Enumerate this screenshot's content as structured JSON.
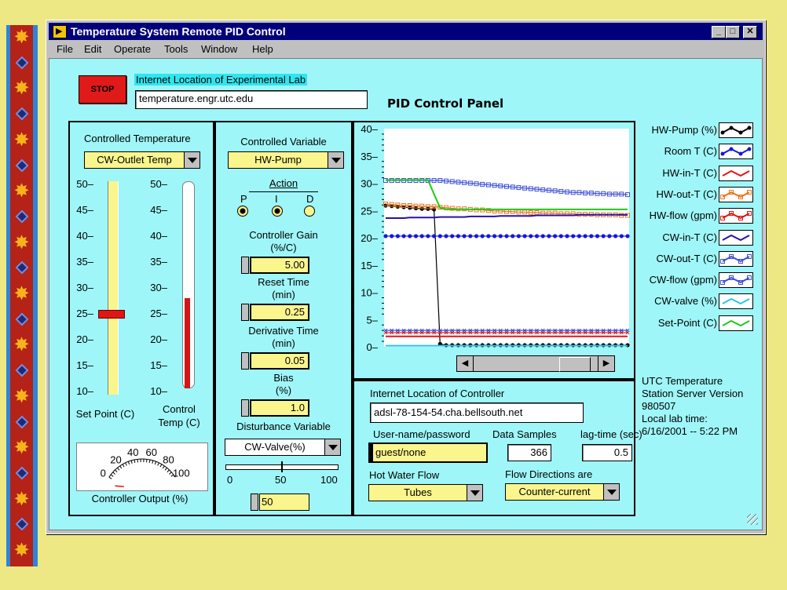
{
  "window": {
    "title": "Temperature System Remote PID Control",
    "minimize": "_",
    "maximize": "□",
    "close": "✕"
  },
  "menu": [
    "File",
    "Edit",
    "Operate",
    "Tools",
    "Window",
    "Help"
  ],
  "header": {
    "stop_label": "STOP",
    "lab_location_label": "Internet Location of Experimental Lab",
    "lab_location_value": "temperature.engr.utc.edu",
    "panel_title": "PID Control Panel"
  },
  "temperature": {
    "controlled_label": "Controlled Temperature",
    "controlled_value": "CW-Outlet Temp",
    "scale": [
      "50",
      "45",
      "40",
      "35",
      "30",
      "25",
      "20",
      "15",
      "10"
    ],
    "set_point_value": 25,
    "control_temp_value": 28,
    "set_point_label": "Set Point (C)",
    "control_temp_label": "Control Temp (C)"
  },
  "meter": {
    "labels": [
      "0",
      "20",
      "40",
      "60",
      "80",
      "100"
    ],
    "value_fraction": 0.0,
    "title": "Controller Output (%)"
  },
  "controller": {
    "variable_label": "Controlled Variable",
    "variable_value": "HW-Pump",
    "action_label": "Action",
    "action_letters": [
      "P",
      "I",
      "D"
    ],
    "action_states": [
      true,
      true,
      false
    ],
    "gain_label_1": "Controller Gain",
    "gain_label_2": "(%/C)",
    "gain_value": "5.00",
    "reset_label_1": "Reset Time",
    "reset_label_2": "(min)",
    "reset_value": "0.25",
    "deriv_label_1": "Derivative Time",
    "deriv_label_2": "(min)",
    "deriv_value": "0.05",
    "bias_label_1": "Bias",
    "bias_label_2": "(%)",
    "bias_value": "1.0",
    "disturbance_label": "Disturbance Variable",
    "disturbance_value": "CW-Valve(%)",
    "slider_ticks": [
      "0",
      "50",
      "100"
    ],
    "slider_fraction": 0.5,
    "disturbance_numeric": "50"
  },
  "chart_data": {
    "type": "line",
    "ylim": [
      0,
      40
    ],
    "yticks": [
      "40",
      "35",
      "30",
      "25",
      "20",
      "15",
      "10",
      "5",
      "0"
    ],
    "x": [
      0,
      1,
      2,
      3,
      4,
      5,
      6,
      7,
      8,
      9,
      10,
      11,
      12,
      13,
      14,
      15,
      16,
      17,
      18,
      19,
      20,
      21,
      22,
      23,
      24,
      25,
      26,
      27,
      28,
      29,
      30,
      31,
      32,
      33,
      34,
      35,
      36,
      37,
      38,
      39,
      40
    ],
    "series": [
      {
        "name": "HW-Pump (%)",
        "color": "#000000",
        "marker": "dot",
        "values": [
          25.9,
          25.8,
          25.7,
          25.6,
          25.5,
          25.4,
          25.3,
          25.3,
          25.2,
          0.5,
          0.3,
          0.3,
          0.3,
          0.3,
          0.3,
          0.3,
          0.3,
          0.3,
          0.3,
          0.3,
          0.3,
          0.3,
          0.3,
          0.3,
          0.3,
          0.3,
          0.3,
          0.3,
          0.3,
          0.3,
          0.3,
          0.3,
          0.3,
          0.3,
          0.3,
          0.3,
          0.3,
          0.3,
          0.3,
          0.3,
          0.3
        ]
      },
      {
        "name": "Room T (C)",
        "color": "#1515e0",
        "marker": "dot",
        "values": [
          20.3,
          20.3,
          20.3,
          20.3,
          20.3,
          20.3,
          20.3,
          20.3,
          20.3,
          20.3,
          20.3,
          20.3,
          20.3,
          20.3,
          20.3,
          20.3,
          20.3,
          20.3,
          20.3,
          20.3,
          20.3,
          20.3,
          20.3,
          20.3,
          20.3,
          20.3,
          20.3,
          20.3,
          20.3,
          20.3,
          20.3,
          20.3,
          20.3,
          20.3,
          20.3,
          20.3,
          20.3,
          20.3,
          20.3,
          20.3,
          20.3
        ]
      },
      {
        "name": "HW-in-T (C)",
        "color": "#e01515",
        "marker": "none",
        "values": [
          1.9,
          1.9,
          1.9,
          1.9,
          1.9,
          1.9,
          1.9,
          1.9,
          1.9,
          1.9,
          1.9,
          1.9,
          1.9,
          1.9,
          1.9,
          1.9,
          1.9,
          1.9,
          1.9,
          1.9,
          1.9,
          1.9,
          1.9,
          1.9,
          1.9,
          1.9,
          1.9,
          1.9,
          1.9,
          1.9,
          1.9,
          1.9,
          1.9,
          1.9,
          1.9,
          1.9,
          1.9,
          1.9,
          1.9,
          1.9,
          1.9
        ]
      },
      {
        "name": "HW-out-T (C)",
        "color": "#e8761f",
        "marker": "square",
        "values": [
          26.2,
          26.1,
          26.0,
          25.9,
          25.9,
          25.8,
          25.8,
          25.7,
          25.7,
          25.6,
          25.5,
          25.4,
          25.3,
          25.3,
          25.2,
          25.1,
          25.1,
          25.0,
          24.9,
          24.9,
          24.8,
          24.8,
          24.7,
          24.7,
          24.6,
          24.6,
          24.5,
          24.5,
          24.5,
          24.4,
          24.4,
          24.4,
          24.3,
          24.3,
          24.3,
          24.2,
          24.2,
          24.2,
          24.2,
          24.1,
          24.1
        ]
      },
      {
        "name": "HW-flow (gpm)",
        "color": "#e01515",
        "marker": "x",
        "values": [
          2.6,
          2.6,
          2.6,
          2.6,
          2.6,
          2.6,
          2.6,
          2.6,
          2.6,
          2.6,
          2.6,
          2.6,
          2.6,
          2.6,
          2.6,
          2.6,
          2.6,
          2.6,
          2.6,
          2.6,
          2.6,
          2.6,
          2.6,
          2.6,
          2.6,
          2.6,
          2.6,
          2.6,
          2.6,
          2.6,
          2.6,
          2.6,
          2.6,
          2.6,
          2.6,
          2.6,
          2.6,
          2.6,
          2.6,
          2.6,
          2.6
        ]
      },
      {
        "name": "CW-in-T (C)",
        "color": "#2a10a8",
        "marker": "none",
        "values": [
          23.6,
          23.6,
          23.6,
          23.6,
          23.7,
          23.7,
          23.7,
          23.7,
          23.7,
          23.8,
          23.8,
          23.8,
          23.8,
          23.8,
          23.9,
          23.9,
          23.9,
          23.9,
          23.9,
          24.0,
          24.0,
          24.0,
          24.0,
          24.0,
          24.0,
          24.1,
          24.1,
          24.1,
          24.1,
          24.1,
          24.1,
          24.1,
          24.2,
          24.2,
          24.2,
          24.2,
          24.2,
          24.2,
          24.2,
          24.2,
          24.2
        ]
      },
      {
        "name": "CW-out-T (C)",
        "color": "#3c4fd6",
        "marker": "square",
        "values": [
          30.5,
          30.5,
          30.5,
          30.5,
          30.5,
          30.5,
          30.5,
          30.5,
          30.5,
          30.5,
          30.4,
          30.3,
          30.2,
          30.1,
          30.0,
          29.9,
          29.8,
          29.7,
          29.6,
          29.5,
          29.4,
          29.3,
          29.2,
          29.1,
          29.0,
          28.9,
          28.8,
          28.7,
          28.6,
          28.5,
          28.4,
          28.3,
          28.3,
          28.2,
          28.2,
          28.1,
          28.1,
          28.0,
          28.0,
          28.0,
          27.9
        ]
      },
      {
        "name": "CW-flow (gpm)",
        "color": "#3c4fd6",
        "marker": "x",
        "values": [
          3.0,
          3.0,
          3.0,
          3.0,
          3.0,
          3.0,
          3.0,
          3.0,
          3.0,
          3.0,
          3.0,
          3.0,
          3.0,
          3.0,
          3.0,
          3.0,
          3.0,
          3.0,
          3.0,
          3.0,
          3.0,
          3.0,
          3.0,
          3.0,
          3.0,
          3.0,
          3.0,
          3.0,
          3.0,
          3.0,
          3.0,
          3.0,
          3.0,
          3.0,
          3.0,
          3.0,
          3.0,
          3.0,
          3.0,
          3.0,
          3.0
        ]
      },
      {
        "name": "CW-valve (%)",
        "color": "#2cc3ea",
        "marker": "none",
        "values": [
          0.2,
          0.2,
          0.2,
          0.2,
          0.2,
          0.2,
          0.2,
          0.2,
          0.2,
          0.2,
          0.2,
          0.2,
          0.2,
          0.2,
          0.2,
          0.2,
          0.2,
          0.2,
          0.2,
          0.2,
          0.2,
          0.2,
          0.2,
          0.2,
          0.2,
          0.2,
          0.2,
          0.2,
          0.2,
          0.2,
          0.2,
          0.2,
          0.2,
          0.2,
          0.2,
          0.2,
          0.2,
          0.2,
          0.2,
          0.2,
          0.2
        ]
      },
      {
        "name": "Set-Point (C)",
        "color": "#21c81a",
        "marker": "none",
        "values": [
          30.6,
          30.6,
          30.6,
          30.6,
          30.6,
          30.6,
          30.6,
          30.6,
          28.0,
          25.5,
          25.2,
          25.2,
          25.2,
          25.2,
          25.2,
          25.2,
          25.2,
          25.2,
          25.2,
          25.2,
          25.2,
          25.2,
          25.2,
          25.2,
          25.2,
          25.2,
          25.2,
          25.2,
          25.2,
          25.2,
          25.2,
          25.2,
          25.2,
          25.2,
          25.2,
          25.2,
          25.2,
          25.2,
          25.2,
          25.2,
          25.2
        ]
      }
    ]
  },
  "info": {
    "line1": "UTC Temperature",
    "line2": "Station Server Version",
    "line3": "980507",
    "line4": "Local lab time:",
    "line5": "6/16/2001 -- 5:22 PM"
  },
  "remote": {
    "controller_location_label": "Internet Location of Controller",
    "controller_location_value": "adsl-78-154-54.cha.bellsouth.net",
    "user_label": "User-name/password",
    "user_value": "guest/none",
    "samples_label": "Data Samples",
    "samples_value": "366",
    "lag_label": "lag-time (sec)",
    "lag_value": "0.5",
    "hw_flow_label": "Hot Water Flow",
    "hw_flow_value": "Tubes",
    "flow_dir_label": "Flow Directions are",
    "flow_dir_value": "Counter-current"
  },
  "scroll": {
    "left": "◀",
    "right": "▶"
  }
}
